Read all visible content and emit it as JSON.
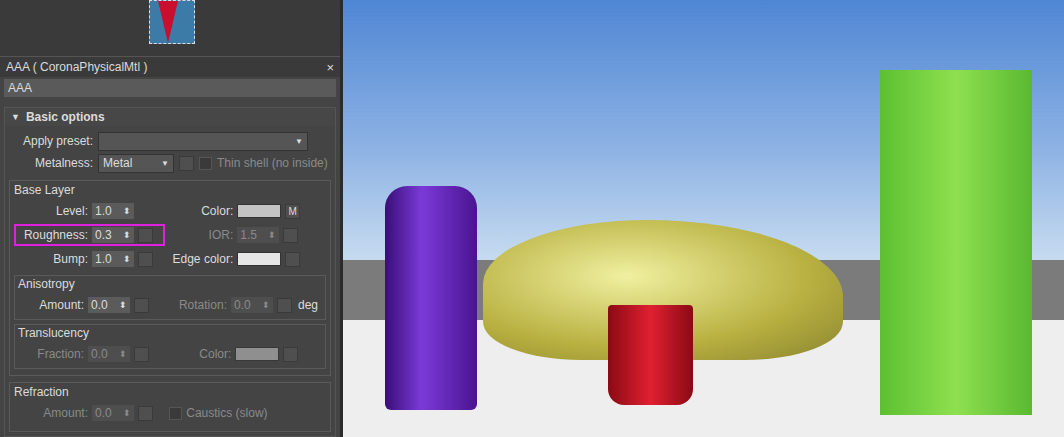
{
  "editor": {
    "title": "AAA  ( CoronaPhysicalMtl )",
    "close": "×",
    "name": "AAA"
  },
  "rollout": {
    "title": "Basic options",
    "arrow": "▼",
    "expanded": true
  },
  "preset": {
    "label": "Apply preset:",
    "value": "",
    "arrow": "▼"
  },
  "metalness": {
    "label": "Metalness:",
    "value": "Metal",
    "arrow": "▼",
    "thin_shell": {
      "label": "Thin shell (no inside)",
      "checked": false,
      "disabled": true
    }
  },
  "base_layer": {
    "title": "Base Layer",
    "rows": [
      [
        {
          "kind": "spinner",
          "label": "Level:",
          "value": "1.0",
          "slot": false,
          "slot_text": "",
          "disabled": false,
          "highlighted": false
        },
        {
          "kind": "color",
          "label": "Color:",
          "color": "#c3c3c3",
          "slot": true,
          "slot_text": "M",
          "disabled": false,
          "highlighted": false
        }
      ],
      [
        {
          "kind": "spinner",
          "label": "Roughness:",
          "value": "0.3",
          "slot": true,
          "slot_text": "",
          "disabled": false,
          "highlighted": true
        },
        {
          "kind": "spinner",
          "label": "IOR:",
          "value": "1.5",
          "slot": true,
          "slot_text": "",
          "disabled": true,
          "highlighted": false
        }
      ],
      [
        {
          "kind": "spinner",
          "label": "Bump:",
          "value": "1.0",
          "slot": true,
          "slot_text": "",
          "disabled": false,
          "highlighted": false
        },
        {
          "kind": "color",
          "label": "Edge color:",
          "color": "#e6e6e6",
          "slot": true,
          "slot_text": "",
          "disabled": false,
          "highlighted": false
        }
      ]
    ]
  },
  "subgroups": [
    {
      "title": "Anisotropy",
      "items": [
        {
          "kind": "spinner",
          "label": "Amount:",
          "value": "0.0",
          "slot": true,
          "slot_text": "",
          "disabled": false,
          "highlighted": false,
          "unit": ""
        },
        {
          "kind": "spinner",
          "label": "Rotation:",
          "value": "0.0",
          "slot": true,
          "slot_text": "",
          "disabled": true,
          "highlighted": false,
          "unit": "deg"
        }
      ]
    },
    {
      "title": "Translucency",
      "items": [
        {
          "kind": "spinner",
          "label": "Fraction:",
          "value": "0.0",
          "slot": true,
          "slot_text": "",
          "disabled": true,
          "highlighted": false,
          "unit": ""
        },
        {
          "kind": "color",
          "label": "Color:",
          "color": "#b0b0b0",
          "slot": true,
          "slot_text": "",
          "disabled": true,
          "highlighted": false,
          "unit": ""
        }
      ]
    }
  ],
  "refraction": {
    "title": "Refraction",
    "items": [
      {
        "kind": "spinner",
        "label": "Amount:",
        "value": "0.0",
        "slot": true,
        "slot_text": "",
        "disabled": true,
        "highlighted": false
      },
      {
        "kind": "checkbox",
        "label": "Caustics (slow)",
        "checked": false,
        "disabled": true
      }
    ]
  }
}
